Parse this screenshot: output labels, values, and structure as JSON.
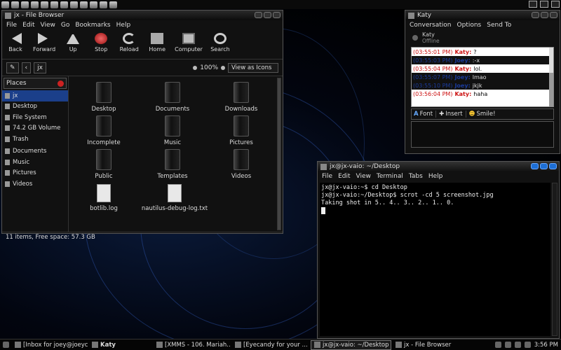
{
  "file_browser": {
    "title": "jx - File Browser",
    "menu": [
      "File",
      "Edit",
      "View",
      "Go",
      "Bookmarks",
      "Help"
    ],
    "toolbar": {
      "back": "Back",
      "forward": "Forward",
      "up": "Up",
      "stop": "Stop",
      "reload": "Reload",
      "home": "Home",
      "computer": "Computer",
      "search": "Search"
    },
    "location": "jx",
    "zoom": "100%",
    "view_mode": "View as Icons",
    "places_label": "Places",
    "places": [
      "jx",
      "Desktop",
      "File System",
      "74.2 GB Volume",
      "Trash"
    ],
    "bookmarks": [
      "Documents",
      "Music",
      "Pictures",
      "Videos"
    ],
    "items": [
      "Desktop",
      "Documents",
      "Downloads",
      "Incomplete",
      "Music",
      "Pictures",
      "Public",
      "Templates",
      "Videos",
      "botlib.log",
      "nautilus-debug-log.txt"
    ],
    "status": "11 items, Free space: 57.3 GB"
  },
  "chat": {
    "title": "Katy",
    "menu": [
      "Conversation",
      "Options",
      "Send To"
    ],
    "contact_name": "Katy",
    "contact_status": "Offline",
    "messages": [
      {
        "time": "(03:55:01 PM)",
        "name": "Katy:",
        "text": "?"
      },
      {
        "time": "(03:55:03 PM)",
        "name": "Joey:",
        "text": ":-x"
      },
      {
        "time": "(03:55:04 PM)",
        "name": "Katy:",
        "text": "lol."
      },
      {
        "time": "(03:55:07 PM)",
        "name": "Joey:",
        "text": "lmao"
      },
      {
        "time": "(03:55:10 PM)",
        "name": "Joey:",
        "text": "jkjk"
      },
      {
        "time": "(03:56:04 PM)",
        "name": "Katy:",
        "text": "haha"
      }
    ],
    "tools": {
      "font": "Font",
      "insert": "Insert",
      "smile": "Smile!"
    }
  },
  "terminal": {
    "title": "jx@jx-vaio: ~/Desktop",
    "menu": [
      "File",
      "Edit",
      "View",
      "Terminal",
      "Tabs",
      "Help"
    ],
    "lines": [
      "jx@jx-vaio:~$ cd Desktop",
      "jx@jx-vaio:~/Desktop$ scrot -cd 5 screenshot.jpg",
      "Taking shot in 5.. 4.. 3.. 2.. 1.. 0."
    ]
  },
  "taskbar": {
    "tasks": [
      "[Inbox for joey@joeyc...",
      "Katy",
      "[XMMS - 106. Mariah...",
      "[Eyecandy for your ...",
      "jx@jx-vaio: ~/Desktop",
      "jx - File Browser"
    ],
    "clock": "3:56 PM"
  }
}
